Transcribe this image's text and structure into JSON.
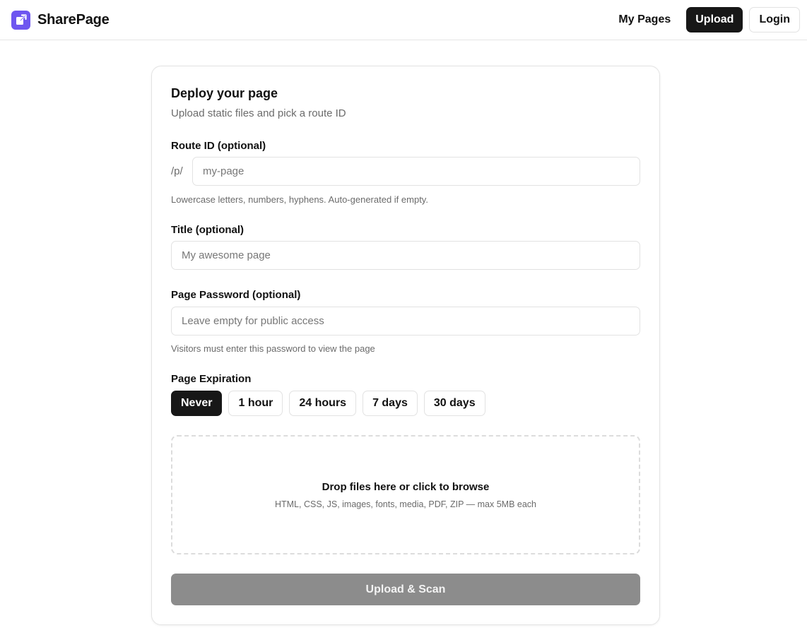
{
  "header": {
    "brand": "SharePage",
    "nav": {
      "my_pages": "My Pages",
      "upload": "Upload",
      "login": "Login"
    }
  },
  "form": {
    "title": "Deploy your page",
    "subtitle": "Upload static files and pick a route ID",
    "route": {
      "label": "Route ID (optional)",
      "prefix": "/p/",
      "value": "",
      "placeholder": "my-page",
      "hint": "Lowercase letters, numbers, hyphens. Auto-generated if empty."
    },
    "title_field": {
      "label": "Title (optional)",
      "value": "",
      "placeholder": "My awesome page"
    },
    "password": {
      "label": "Page Password (optional)",
      "value": "",
      "placeholder": "Leave empty for public access",
      "hint": "Visitors must enter this password to view the page"
    },
    "expiration": {
      "label": "Page Expiration",
      "options": [
        "Never",
        "1 hour",
        "24 hours",
        "7 days",
        "30 days"
      ],
      "selected": "Never"
    },
    "dropzone": {
      "title": "Drop files here or click to browse",
      "subtitle": "HTML, CSS, JS, images, fonts, media, PDF, ZIP — max 5MB each"
    },
    "submit_label": "Upload & Scan"
  },
  "colors": {
    "brand_accent": "#6e56f0",
    "primary_dark": "#171717",
    "submit_disabled": "#8c8c8c"
  },
  "icons": {
    "logo": "share-arrow-icon"
  }
}
